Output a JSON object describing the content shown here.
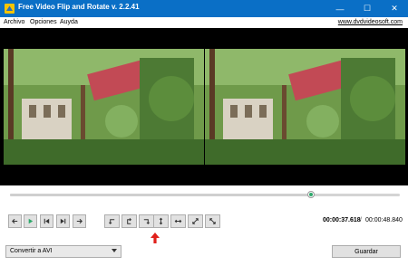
{
  "window": {
    "title": "Free Video Flip and Rotate v. 2.2.41",
    "minimize_glyph": "—",
    "maximize_glyph": "☐",
    "close_glyph": "✕"
  },
  "menu": {
    "items": [
      "Archivo",
      "Opciones",
      "Auyda"
    ],
    "site_link": "www.dvdvideosoft.com"
  },
  "playback": {
    "progress_fraction": 0.773,
    "current_time": "00:00:37.618",
    "separator": "/",
    "total_time": "00:00:48.840"
  },
  "transport_buttons": [
    {
      "name": "step-back-button",
      "icon": "arrow-left-icon"
    },
    {
      "name": "play-button",
      "icon": "play-icon"
    },
    {
      "name": "previous-frame-button",
      "icon": "skip-previous-icon"
    },
    {
      "name": "next-frame-button",
      "icon": "skip-next-icon"
    },
    {
      "name": "step-forward-button",
      "icon": "arrow-right-icon"
    }
  ],
  "rotate_buttons": [
    {
      "name": "rotate-left-button",
      "icon": "rotate-left-icon"
    },
    {
      "name": "rotate-180-button",
      "icon": "rotate-180-icon"
    },
    {
      "name": "rotate-right-button",
      "icon": "rotate-right-icon"
    },
    {
      "name": "flip-vertical-button",
      "icon": "flip-vertical-icon"
    },
    {
      "name": "flip-horizontal-button",
      "icon": "flip-horizontal-icon"
    },
    {
      "name": "transpose-button",
      "icon": "diagonal-arrow-icon"
    },
    {
      "name": "transverse-button",
      "icon": "anti-diagonal-arrow-icon"
    }
  ],
  "output": {
    "format_selected": "Convertir a AVI",
    "save_label": "Guardar"
  },
  "colors": {
    "titlebar": "#0a6fc6",
    "accent_green": "#2ea86b",
    "highlight_arrow": "#e0201b"
  }
}
